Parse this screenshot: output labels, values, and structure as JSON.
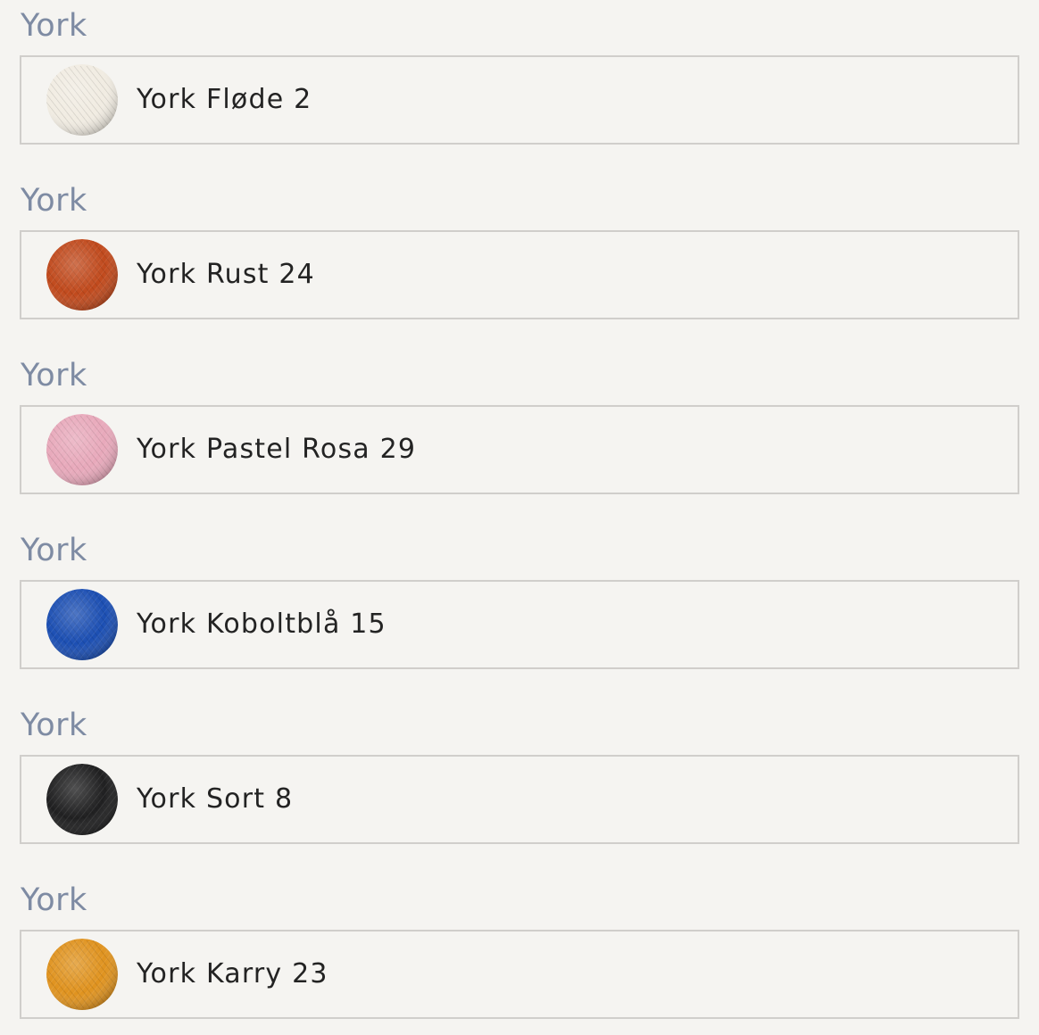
{
  "items": [
    {
      "group_label": "York",
      "name": "York Fløde 2",
      "color": "#f1ece2"
    },
    {
      "group_label": "York",
      "name": "York Rust 24",
      "color": "#c14a1d"
    },
    {
      "group_label": "York",
      "name": "York Pastel Rosa 29",
      "color": "#e8a9bb"
    },
    {
      "group_label": "York",
      "name": "York Koboltblå 15",
      "color": "#1c4fb3"
    },
    {
      "group_label": "York",
      "name": "York Sort 8",
      "color": "#202021"
    },
    {
      "group_label": "York",
      "name": "York Karry 23",
      "color": "#e0931f"
    }
  ]
}
